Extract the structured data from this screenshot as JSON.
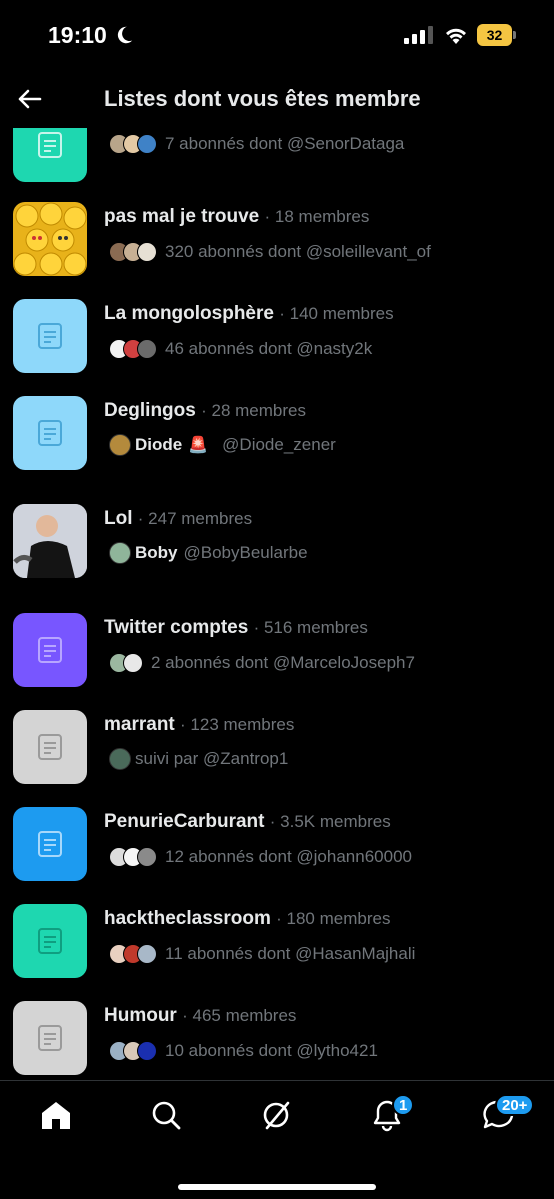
{
  "status": {
    "time": "19:10",
    "battery": "32"
  },
  "header": {
    "title": "Listes dont vous êtes membre"
  },
  "lists": [
    {
      "name": "",
      "count": "",
      "sub": "7 abonnés dont @SenorDataga",
      "thumb": "icon",
      "color": "#1ed7b0"
    },
    {
      "name": "pas mal je trouve",
      "count": "· 18 membres",
      "sub": "320 abonnés dont @soleillevant_of",
      "thumb": "emoji",
      "color": "#e8b21a"
    },
    {
      "name": "La mongolosphère",
      "count": "· 140 membres",
      "sub": "46 abonnés dont @nasty2k",
      "thumb": "icon",
      "color": "#8ed8fa"
    },
    {
      "name": "Deglingos",
      "count": "· 28 membres",
      "owner": "Diode",
      "sub": "@Diode_zener",
      "thumb": "icon",
      "color": "#8ed8fa"
    },
    {
      "name": "Lol",
      "count": "· 247 membres",
      "owner": "Boby",
      "sub": "@BobyBeularbe",
      "thumb": "photo",
      "color": "#d9dde6"
    },
    {
      "name": "Twitter comptes",
      "count": "· 516 membres",
      "sub": "2 abonnés dont @MarceloJoseph7",
      "thumb": "icon",
      "color": "#7856ff"
    },
    {
      "name": "marrant",
      "count": "· 123 membres",
      "sub": "suivi par @Zantrop1",
      "thumb": "icon",
      "color": "#d4d4d4"
    },
    {
      "name": "PenurieCarburant",
      "count": "· 3.5K membres",
      "sub": "12 abonnés dont @johann60000",
      "thumb": "icon",
      "color": "#1d9bf0"
    },
    {
      "name": "hacktheclassroom",
      "count": "· 180 membres",
      "sub": "11 abonnés dont @HasanMajhali",
      "thumb": "icon",
      "color": "#1ed7b0"
    },
    {
      "name": "Humour",
      "count": "· 465 membres",
      "sub": "10 abonnés dont @lytho421",
      "thumb": "icon",
      "color": "#d4d4d4"
    }
  ],
  "tabbar": {
    "notifications_badge": "1",
    "messages_badge": "20+"
  },
  "colors": {
    "accent": "#1d9bf0",
    "muted": "#71767b",
    "text": "#e7e9ea"
  }
}
